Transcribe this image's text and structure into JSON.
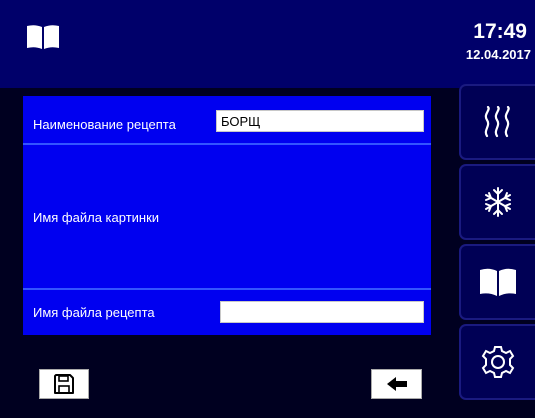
{
  "header": {
    "time": "17:49",
    "date": "12.04.2017",
    "book_icon": "book-icon"
  },
  "form": {
    "recipe_name_label": "Наименование рецепта",
    "recipe_name_value": "БОРЩ",
    "image_file_label": "Имя файла картинки",
    "recipe_file_label": "Имя файла рецепта",
    "recipe_file_value": ""
  },
  "sidebar": {
    "items": [
      {
        "icon": "heat-icon"
      },
      {
        "icon": "snowflake-icon"
      },
      {
        "icon": "book-icon"
      },
      {
        "icon": "gear-icon"
      }
    ]
  },
  "footer": {
    "save_icon": "save-icon",
    "back_icon": "arrow-left-icon"
  },
  "colors": {
    "panel": "#0000f0",
    "header": "#00006a",
    "background": "#000020",
    "sidebar_button": "#000055"
  }
}
